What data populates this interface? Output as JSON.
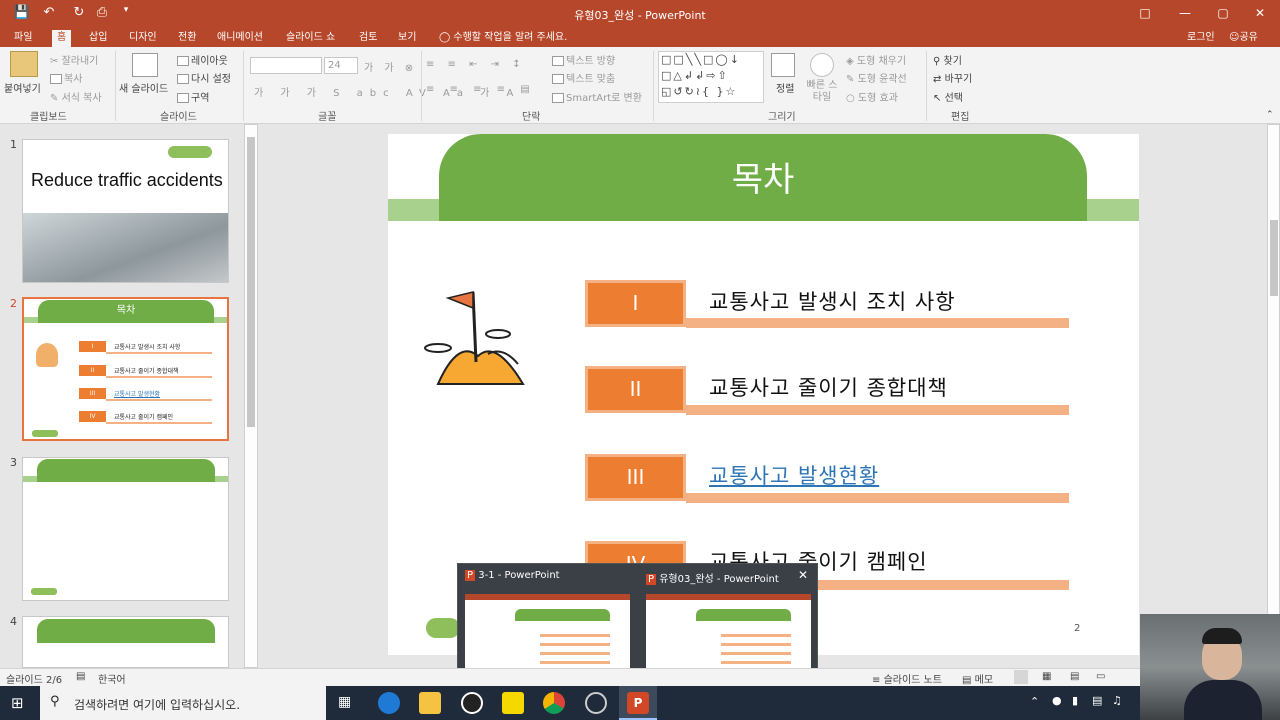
{
  "window": {
    "title": "유형03_완성 - PowerPoint"
  },
  "tabs": [
    "파일",
    "홈",
    "삽입",
    "디자인",
    "전환",
    "애니메이션",
    "슬라이드 쇼",
    "검토",
    "보기"
  ],
  "tell_me": "수행할 작업을 알려 주세요.",
  "account": {
    "login": "로그인",
    "share": "공유"
  },
  "ribbon": {
    "paste": "붙여넣기",
    "cut": "잘라내기",
    "copy": "복사",
    "format_painter": "서식 복사",
    "new_slide": "새 슬라이드",
    "layout": "레이아웃",
    "reset": "다시 설정",
    "section": "구역",
    "font_size": "24",
    "text_direction": "텍스트 방향",
    "align_text": "텍스트 맞춤",
    "smartart": "SmartArt로 변환",
    "arrange": "정렬",
    "quick_styles": "빠른 스타일",
    "shape_fill": "도형 채우기",
    "shape_outline": "도형 윤곽선",
    "shape_effects": "도형 효과",
    "find": "찾기",
    "replace": "바꾸기",
    "select": "선택",
    "groups": {
      "clipboard": "클립보드",
      "slides": "슬라이드",
      "font": "글꼴",
      "paragraph": "단락",
      "drawing": "그리기",
      "editing": "편집"
    }
  },
  "thumbnails": {
    "numbers": [
      "1",
      "2",
      "3",
      "4"
    ],
    "slide1_title": "Reduce traffic accidents",
    "slide2_title": "목차",
    "slide2_items": [
      "교통사고 발생시 조치 사항",
      "교통사고 줄이기 종합대책",
      "교통사고 발생현황",
      "교통사고 줄이기 캠페인"
    ],
    "numerals": [
      "I",
      "II",
      "III",
      "IV"
    ]
  },
  "slide": {
    "title": "목차",
    "numerals": [
      "I",
      "II",
      "III",
      "IV"
    ],
    "items": [
      "교통사고 발생시 조치 사항",
      "교통사고 줄이기 종합대책",
      "교통사고 발생현황",
      "교통사고 줄이기 캠페인"
    ],
    "page_number": "2"
  },
  "status": {
    "slide_indicator": "슬라이드 2/6",
    "language": "한국어",
    "notes": "슬라이드 노트",
    "comments": "메모"
  },
  "preview": {
    "window1": "3-1 - PowerPoint",
    "window2": "유형03_완성 - PowerPoint"
  },
  "taskbar": {
    "search_placeholder": "검색하려면 여기에 입력하십시오."
  },
  "colors": {
    "accent": "#b7472a",
    "slide_green": "#70ad47",
    "orange": "#ed7d31"
  }
}
